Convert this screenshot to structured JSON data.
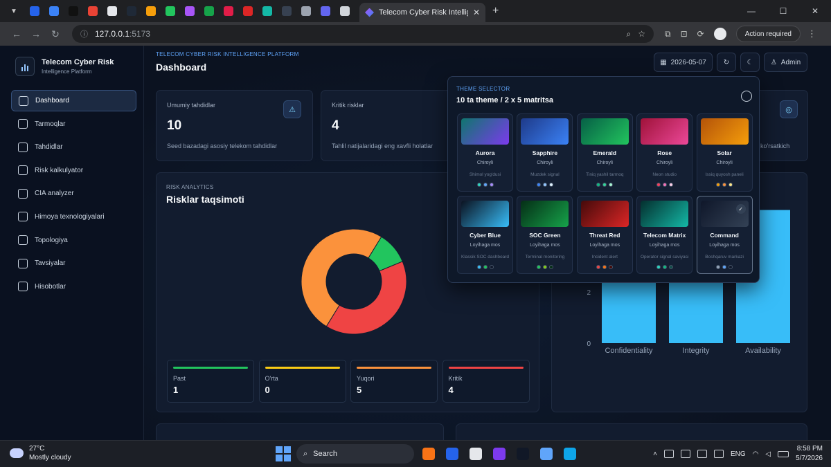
{
  "browser": {
    "tab_title": "Telecom Cyber Risk Intelligence",
    "url_host": "127.0.0.1",
    "url_port": ":5173",
    "action_required": "Action required",
    "pinned_colors": [
      "#2563eb",
      "#3b82f6",
      "#111111",
      "#ea4335",
      "#e5e7eb",
      "#1f2937",
      "#f59e0b",
      "#22c55e",
      "#a855f7",
      "#16a34a",
      "#e11d48",
      "#dc2626",
      "#14b8a6",
      "#374151",
      "#9ca3af",
      "#6366f1",
      "#d1d5db"
    ]
  },
  "sidebar": {
    "brand_title": "Telecom Cyber Risk",
    "brand_sub": "Intelligence Platform",
    "items": [
      {
        "label": "Dashboard",
        "icon": "grid-icon"
      },
      {
        "label": "Tarmoqlar",
        "icon": "network-icon"
      },
      {
        "label": "Tahdidlar",
        "icon": "alarm-icon"
      },
      {
        "label": "Risk kalkulyator",
        "icon": "calculator-icon"
      },
      {
        "label": "CIA analyzer",
        "icon": "radar-icon"
      },
      {
        "label": "Himoya texnologiyalari",
        "icon": "shield-icon"
      },
      {
        "label": "Topologiya",
        "icon": "topology-icon"
      },
      {
        "label": "Tavsiyalar",
        "icon": "chip-icon"
      },
      {
        "label": "Hisobotlar",
        "icon": "document-icon"
      }
    ]
  },
  "header": {
    "crumb": "TELECOM CYBER RISK INTELLIGENCE PLATFORM",
    "title": "Dashboard",
    "date": "2026-05-07",
    "user": "Admin"
  },
  "stats": [
    {
      "label": "Umumiy tahdidlar",
      "value": "10",
      "desc": "Seed bazadagi asosiy telekom tahdidlar"
    },
    {
      "label": "Kritik risklar",
      "value": "4",
      "desc": "Tahlil natijalaridagi eng xavfli holatlar"
    },
    {
      "desc_partial": "ko'rsatkich"
    }
  ],
  "risk_section": {
    "label": "RISK ANALYTICS",
    "title": "Risklar taqsimoti",
    "tiles": [
      {
        "label": "Past",
        "value": "1",
        "color": "#22c55e"
      },
      {
        "label": "O'rta",
        "value": "0",
        "color": "#facc15"
      },
      {
        "label": "Yuqori",
        "value": "5",
        "color": "#fb923c"
      },
      {
        "label": "Kritik",
        "value": "4",
        "color": "#ef4444"
      }
    ]
  },
  "chart_data": [
    {
      "type": "pie",
      "categories": [
        "Past",
        "O'rta",
        "Yuqori",
        "Kritik"
      ],
      "values": [
        1,
        0,
        5,
        4
      ],
      "colors": [
        "#22c55e",
        "#facc15",
        "#fb923c",
        "#ef4444"
      ],
      "donut": true
    },
    {
      "type": "bar",
      "categories": [
        "Confidentiality",
        "Integrity",
        "Availability"
      ],
      "values": [
        2.5,
        2.5,
        2.5
      ],
      "color": "#38bdf8",
      "yticks_visible": [
        "0",
        "2"
      ],
      "grid": false
    }
  ],
  "theme_selector": {
    "label": "THEME SELECTOR",
    "title": "10 ta theme / 2 x 5 matritsa",
    "themes": [
      {
        "name": "Aurora",
        "mode": "Chiroyli",
        "desc": "Shimol yog'dusi",
        "g1": "#0f766e",
        "g2": "#7c3aed",
        "dots": [
          "#2dd4bf",
          "#60a5fa",
          "#a78bfa"
        ]
      },
      {
        "name": "Sapphire",
        "mode": "Chiroyli",
        "desc": "Muzdek signal",
        "g1": "#1e3a8a",
        "g2": "#3b82f6",
        "dots": [
          "#3b82f6",
          "#93c5fd",
          "#e0f2fe"
        ]
      },
      {
        "name": "Emerald",
        "mode": "Chiroyli",
        "desc": "Tiniq yashil tarmoq",
        "g1": "#065f46",
        "g2": "#22c55e",
        "dots": [
          "#10b981",
          "#34d399",
          "#a7f3d0"
        ]
      },
      {
        "name": "Rose",
        "mode": "Chiroyli",
        "desc": "Neon studio",
        "g1": "#9f1239",
        "g2": "#ec4899",
        "dots": [
          "#f43f5e",
          "#f472b6",
          "#fbcfe8"
        ]
      },
      {
        "name": "Solar",
        "mode": "Chiroyli",
        "desc": "Issiq quyosh paneli",
        "g1": "#b45309",
        "g2": "#f59e0b",
        "dots": [
          "#f59e0b",
          "#fb923c",
          "#fde68a"
        ]
      },
      {
        "name": "Cyber Blue",
        "mode": "Loyihaga mos",
        "desc": "Klassik SOC dashboard",
        "g1": "#0b1220",
        "g2": "#38bdf8",
        "dots": [
          "#38bdf8",
          "#22c55e",
          "#0f172a"
        ]
      },
      {
        "name": "SOC Green",
        "mode": "Loyihaga mos",
        "desc": "Terminal monitoring",
        "g1": "#052e16",
        "g2": "#16a34a",
        "dots": [
          "#22c55e",
          "#84cc16",
          "#052e16"
        ]
      },
      {
        "name": "Threat Red",
        "mode": "Loyihaga mos",
        "desc": "Incident alert",
        "g1": "#450a0a",
        "g2": "#dc2626",
        "dots": [
          "#ef4444",
          "#f97316",
          "#450a0a"
        ]
      },
      {
        "name": "Telecom Matrix",
        "mode": "Loyihaga mos",
        "desc": "Operator signal saviyasi",
        "g1": "#042f2e",
        "g2": "#14b8a6",
        "dots": [
          "#2dd4bf",
          "#10b981",
          "#134e4a"
        ]
      },
      {
        "name": "Command",
        "mode": "Loyihaga mos",
        "desc": "Boshqaruv markazi",
        "g1": "#0f172a",
        "g2": "#334155",
        "dots": [
          "#94a3b8",
          "#60a5fa",
          "#0f172a"
        ],
        "selected": true
      }
    ]
  },
  "taskbar": {
    "temp": "27°C",
    "weather": "Mostly cloudy",
    "search": "Search",
    "lang": "ENG",
    "time": "8:58 PM",
    "date": "5/7/2026",
    "app_colors": [
      "#f97316",
      "#2563eb",
      "#e5e7eb",
      "#7c3aed",
      "#111827",
      "#60a5fa",
      "#0ea5e9"
    ]
  }
}
